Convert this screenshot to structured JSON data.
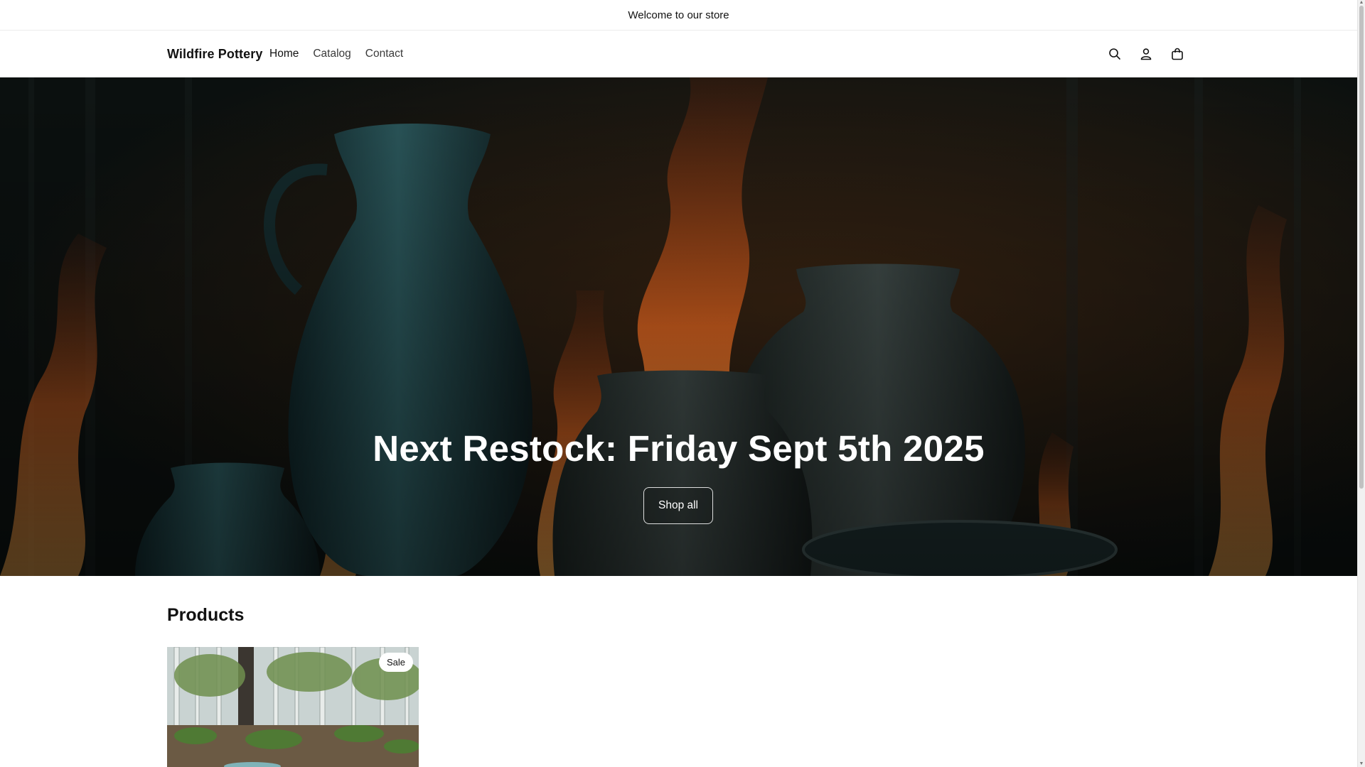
{
  "announcement": {
    "text": "Welcome to our store"
  },
  "header": {
    "logo": "Wildfire Pottery",
    "nav": [
      {
        "label": "Home"
      },
      {
        "label": "Catalog"
      },
      {
        "label": "Contact"
      }
    ],
    "icons": [
      "search-icon",
      "account-icon",
      "cart-icon"
    ]
  },
  "hero": {
    "title": "Next Restock: Friday Sept 5th 2025",
    "button_label": "Shop all"
  },
  "products": {
    "heading": "Products",
    "items": [
      {
        "badge": "Sale"
      }
    ]
  },
  "colors": {
    "text": "#121212",
    "hero_dark": "#0f1413",
    "flame": "#e0722a",
    "pottery_teal": "#1f4a4f"
  }
}
